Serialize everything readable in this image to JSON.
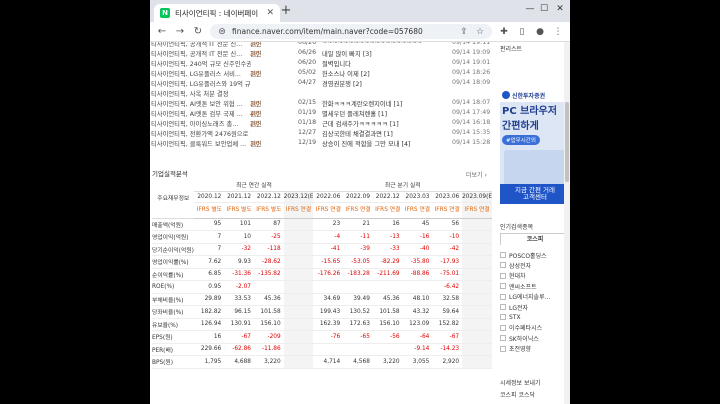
{
  "browser": {
    "tab_title": "티사이언티픽 : 네이버페이 증권",
    "favicon": "N",
    "url": "finance.naver.com/item/main.naver?code=057680"
  },
  "news": [
    {
      "title": "티사이언티픽, 공개적 IT 전문 신...",
      "rel_prefix": "관련 ",
      "rel_count": "3건",
      "date": "06/26",
      "board": "~~~~~~~~~~~~~~~~~~~~",
      "time": "09/14 19:11"
    },
    {
      "title": "티사이언티픽, 공개적 IT 전문 신...",
      "rel_prefix": "관련 ",
      "rel_count": "3건",
      "date": "06/26",
      "board": "내일 많이 빠지 [3]",
      "time": "09/14 19:09"
    },
    {
      "title": "티사이언티픽, 240억 규모 신주인수권 행사",
      "rel_prefix": "",
      "rel_count": "",
      "date": "06/20",
      "board": "절벽입니다",
      "time": "09/14 19:01"
    },
    {
      "title": "티사이언티픽, LG유플러스 서비...",
      "rel_prefix": "관련 ",
      "rel_count": "3건",
      "date": "05/02",
      "board": "헌소스나 이제 [2]",
      "time": "09/14 18:26"
    },
    {
      "title": "티사이언티픽, LG유플러스와 19억 규모 공급계...",
      "rel_prefix": "",
      "rel_count": "",
      "date": "04/27",
      "board": "경영권분쟁 [2]",
      "time": "09/14 18:09"
    },
    {
      "title": "티사이언티픽, 사옥 처분 결정",
      "rel_prefix": "",
      "rel_count": "",
      "date": "",
      "board": "",
      "time": ""
    },
    {
      "title": "티사이언티픽, AI엣톤 보안 위협 ...",
      "rel_prefix": "관련 ",
      "rel_count": "3건",
      "date": "02/15",
      "board": "한화ㅋㅋㅋ계란오렌지이네 [1]",
      "time": "09/14 18:07"
    },
    {
      "title": "티사이언티픽, AI엣톤 검부 국제 ...",
      "rel_prefix": "관련 ",
      "rel_count": "4건",
      "date": "01/19",
      "board": "별세우던 플레쳐렌홀 [1]",
      "time": "09/14 17:49"
    },
    {
      "title": "티사이언티픽, 아이싱노래즈 총...",
      "rel_prefix": "관련 ",
      "rel_count": "2건",
      "date": "01/18",
      "board": "근데 검새주가ㅋㅋㅋㅋㅋ [1]",
      "time": "09/14 16:18"
    },
    {
      "title": "티사이언티픽, 전환가액 2476원으로 하향 조정",
      "rel_prefix": "",
      "rel_count": "",
      "date": "12/27",
      "board": "김상국한테 채결결과면 [1]",
      "time": "09/14 15:35"
    },
    {
      "title": "티사이언티픽, 클룩워드 보안업체 ...",
      "rel_prefix": "관련 ",
      "rel_count": "3건",
      "date": "12/19",
      "board": "상승이 진에 적합을 그만 모내 [4]",
      "time": "09/14 15:28"
    }
  ],
  "finance": {
    "title": "기업실적분석",
    "more": "더보기",
    "row_header": "주요재무정보",
    "annual_header": "최근 연간 실적",
    "quarter_header": "최근 분기 실적",
    "columns": [
      "2020.12",
      "2021.12",
      "2022.12",
      "2023.12(E)",
      "2022.06",
      "2022.09",
      "2022.12",
      "2023.03",
      "2023.06",
      "2023.09(E)"
    ],
    "estimate_cols": [
      3,
      9
    ],
    "ifrs": [
      "IFRS 별도",
      "IFRS 별도",
      "IFRS 별도",
      "IFRS 연결",
      "IFRS 연결",
      "IFRS 연결",
      "IFRS 연결",
      "IFRS 연결",
      "IFRS 연결",
      "IFRS 연결"
    ],
    "rows": [
      {
        "label": "매출액(억원)",
        "values": [
          "95",
          "101",
          "87",
          "",
          "23",
          "21",
          "16",
          "45",
          "56",
          ""
        ]
      },
      {
        "label": "영업이익(억원)",
        "values": [
          "7",
          "10",
          "-25",
          "",
          "-4",
          "-11",
          "-13",
          "-16",
          "-10",
          ""
        ]
      },
      {
        "label": "당기순이익(억원)",
        "values": [
          "7",
          "-32",
          "-118",
          "",
          "-41",
          "-39",
          "-33",
          "-40",
          "-42",
          ""
        ]
      },
      {
        "label": "영업이익률(%)",
        "values": [
          "7.62",
          "9.93",
          "-28.62",
          "",
          "-15.65",
          "-53.05",
          "-82.29",
          "-35.80",
          "-17.93",
          ""
        ]
      },
      {
        "label": "순이익률(%)",
        "values": [
          "6.85",
          "-31.36",
          "-135.82",
          "",
          "-176.26",
          "-183.28",
          "-211.69",
          "-88.86",
          "-75.01",
          ""
        ]
      },
      {
        "label": "ROE(%)",
        "values": [
          "0.95",
          "-2.07",
          "",
          "",
          "",
          "",
          "",
          "",
          "-6.42",
          ""
        ]
      },
      {
        "label": "부채비율(%)",
        "values": [
          "29.89",
          "33.53",
          "45.36",
          "",
          "34.69",
          "39.49",
          "45.36",
          "48.10",
          "32.58",
          ""
        ]
      },
      {
        "label": "당좌비율(%)",
        "values": [
          "182.82",
          "96.15",
          "101.58",
          "",
          "199.43",
          "130.52",
          "101.58",
          "43.32",
          "59.64",
          ""
        ]
      },
      {
        "label": "유보율(%)",
        "values": [
          "126.94",
          "130.91",
          "156.10",
          "",
          "162.39",
          "172.63",
          "156.10",
          "123.09",
          "152.82",
          ""
        ]
      },
      {
        "label": "EPS(원)",
        "values": [
          "16",
          "-67",
          "-209",
          "",
          "-76",
          "-65",
          "-56",
          "-64",
          "-67",
          ""
        ]
      },
      {
        "label": "PER(배)",
        "values": [
          "229.66",
          "-62.86",
          "-11.86",
          "",
          "",
          "",
          "",
          "-9.14",
          "-14.23",
          ""
        ]
      },
      {
        "label": "BPS(원)",
        "values": [
          "1,795",
          "4,688",
          "3,220",
          "",
          "4,714",
          "4,568",
          "3,220",
          "3,055",
          "2,920",
          ""
        ]
      }
    ]
  },
  "sidebar": {
    "title": "펀리스트",
    "ad": {
      "brand": "신한투자증권",
      "headline1": "PC 브라우저",
      "headline2": "간편하게",
      "pill": "#업무시간외",
      "bottom1": "지금 간편 거래",
      "bottom2": "고객센터"
    },
    "popular_title": "인기검색종목",
    "tabs": [
      "코스피",
      "코스닥"
    ],
    "ranks": [
      "POSCO홀딩스",
      "삼성전자",
      "현대차",
      "엔씨소프트",
      "LG에너지솔루...",
      "LG전자",
      "STX",
      "이수페타시스",
      "SK하이닉스",
      "초전영향"
    ],
    "recent_title": "시세정보 보내기",
    "recent_tabs": [
      "코스피",
      "코스닥"
    ]
  }
}
